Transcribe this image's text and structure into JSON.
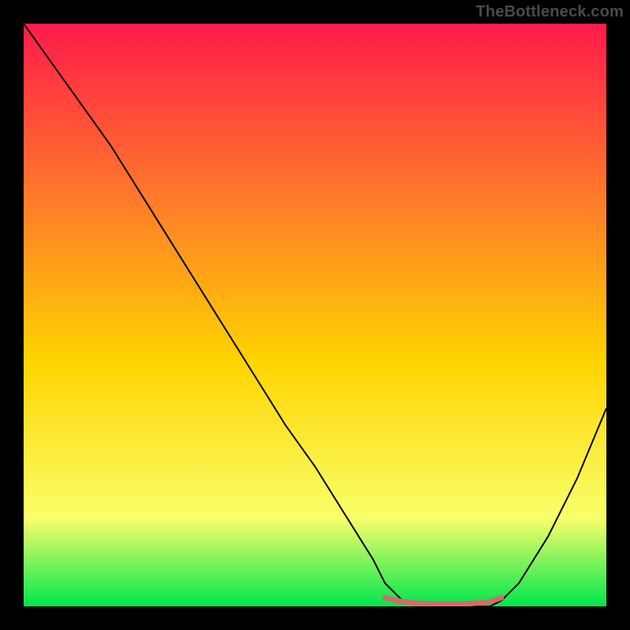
{
  "watermark": "TheBottleneck.com",
  "colors": {
    "gradient_top": "#ff1a4a",
    "gradient_upper_mid": "#ff7a2a",
    "gradient_mid": "#ffd400",
    "gradient_lower_mid": "#f8ff6a",
    "gradient_bottom": "#00e64d",
    "curve_stroke": "#000000",
    "marker_stroke": "#d46a6a",
    "background": "#000000"
  },
  "chart_data": {
    "type": "line",
    "title": "",
    "xlabel": "",
    "ylabel": "",
    "xlim": [
      0,
      100
    ],
    "ylim": [
      0,
      100
    ],
    "grid": false,
    "legend": false,
    "series": [
      {
        "name": "bottleneck-curve",
        "x": [
          0,
          5,
          10,
          15,
          20,
          25,
          30,
          35,
          40,
          45,
          50,
          55,
          60,
          62,
          65,
          70,
          75,
          80,
          82,
          85,
          90,
          95,
          100
        ],
        "y": [
          100,
          93,
          86,
          79,
          71,
          63,
          55,
          47,
          39,
          31,
          24,
          16,
          8,
          4,
          1,
          0,
          0,
          0,
          1,
          4,
          12,
          22,
          34
        ]
      },
      {
        "name": "optimal-range-marker",
        "x": [
          62,
          65,
          68,
          71,
          74,
          77,
          80,
          82
        ],
        "y": [
          1.5,
          0.8,
          0.5,
          0.4,
          0.4,
          0.5,
          0.8,
          1.5
        ]
      }
    ],
    "annotations": []
  }
}
